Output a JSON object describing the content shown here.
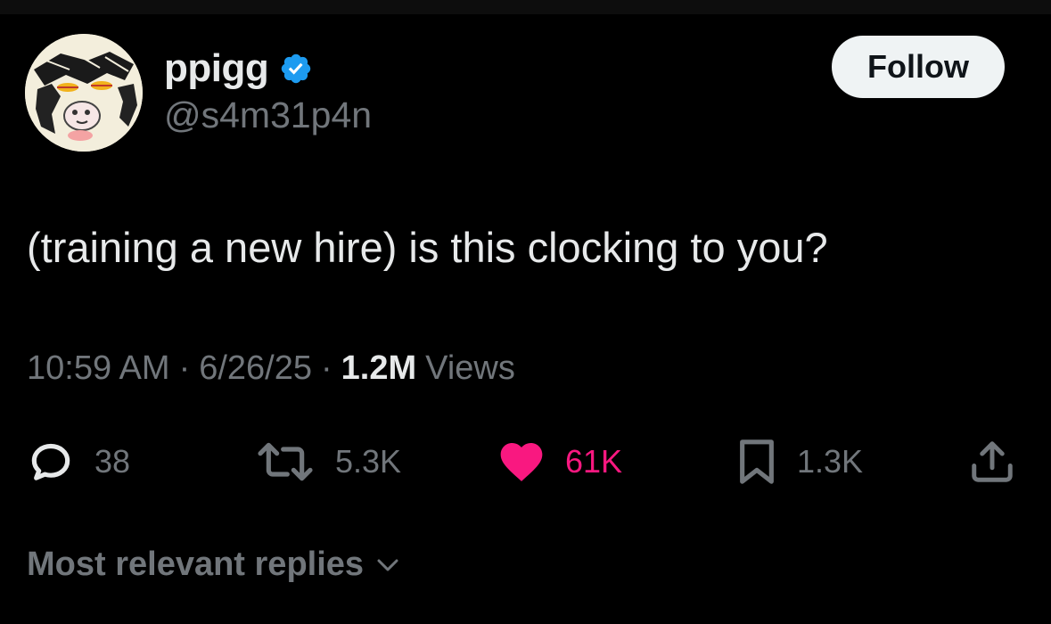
{
  "author": {
    "display_name": "ppigg",
    "handle": "@s4m31p4n",
    "verified": true,
    "verified_color": "#1d9bf0"
  },
  "follow_button": {
    "label": "Follow"
  },
  "tweet": {
    "text": "(training a new hire) is this clocking to you?",
    "time": "10:59 AM",
    "date": "6/26/25",
    "separator": "·",
    "views_count": "1.2M",
    "views_label": "Views"
  },
  "actions": {
    "reply": {
      "icon": "reply-icon",
      "count": "38"
    },
    "repost": {
      "icon": "repost-icon",
      "count": "5.3K"
    },
    "like": {
      "icon": "heart-icon",
      "count": "61K",
      "color": "#f91880",
      "liked": true
    },
    "bookmark": {
      "icon": "bookmark-icon",
      "count": "1.3K"
    },
    "share": {
      "icon": "share-icon"
    }
  },
  "replies": {
    "sort_label": "Most relevant replies"
  },
  "colors": {
    "background": "#000000",
    "primary_text": "#e7e9ea",
    "secondary_text": "#71767b",
    "follow_button_bg": "#eff3f4"
  }
}
